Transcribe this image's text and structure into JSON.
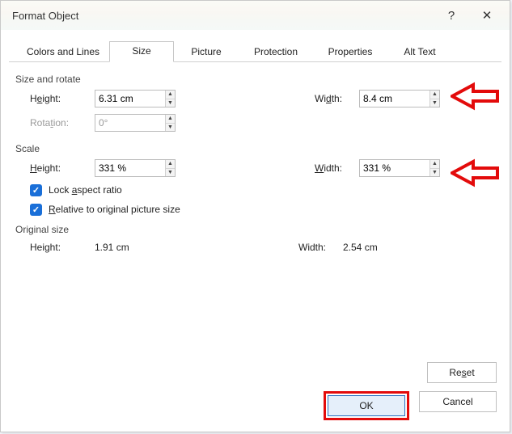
{
  "title": "Format Object",
  "help_symbol": "?",
  "close_symbol": "✕",
  "tabs": {
    "colors_lines": "Colors and Lines",
    "size": "Size",
    "picture": "Picture",
    "protection": "Protection",
    "properties": "Properties",
    "alt_text": "Alt Text"
  },
  "groups": {
    "size_rotate": "Size and rotate",
    "scale": "Scale",
    "original_size": "Original size"
  },
  "labels": {
    "height": "Height:",
    "width": "Width:",
    "rotation": "Rotation:",
    "scale_height": "Height:",
    "scale_width": "Width:",
    "lock_aspect": "Lock aspect ratio",
    "relative_original": "Relative to original picture size"
  },
  "values": {
    "height": "6.31 cm",
    "width": "8.4 cm",
    "rotation": "0°",
    "scale_height": "331 %",
    "scale_width": "331 %",
    "orig_height": "1.91 cm",
    "orig_width": "2.54 cm"
  },
  "buttons": {
    "reset": "Reset",
    "ok": "OK",
    "cancel": "Cancel"
  },
  "underline": {
    "e": "e",
    "d": "d",
    "t": "t",
    "a": "a",
    "r": "R",
    "h": "H",
    "w": "W",
    "s": "s"
  }
}
